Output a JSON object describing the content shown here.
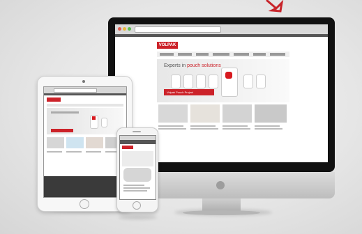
{
  "brand": {
    "name": "VOLPAK",
    "color": "#cc2229"
  },
  "website": {
    "hero_title_prefix": "Experts in ",
    "hero_title_highlight": "pouch solutions",
    "hero_button": "Volpak Pouch Project"
  },
  "icons": {
    "apple": "apple-logo-icon",
    "corner": "red-arrow-icon"
  }
}
